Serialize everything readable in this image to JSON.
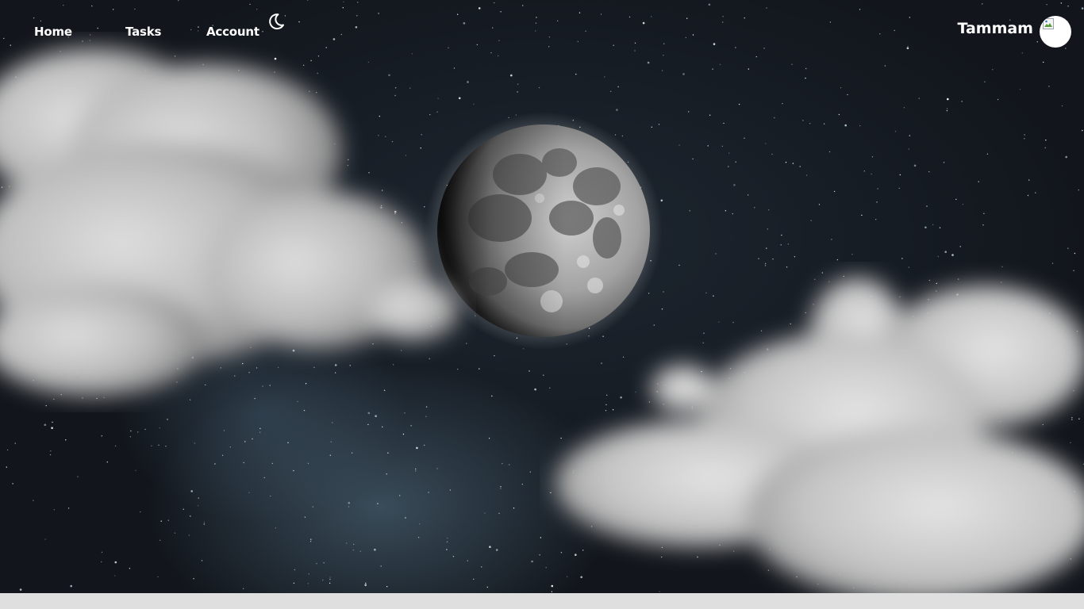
{
  "nav": {
    "links": [
      {
        "label": "Home"
      },
      {
        "label": "Tasks"
      },
      {
        "label": "Account"
      }
    ],
    "theme_toggle_icon": "crescent-moon-icon"
  },
  "user": {
    "name": "Tammam",
    "avatar_icon": "broken-image-icon"
  },
  "scene": {
    "description_icon": "night-sky-moon-clouds",
    "colors": {
      "sky": "#12161c",
      "moon": "#9a9a9a",
      "cloud": "#dcdcdc",
      "footer": "#e0dfdf"
    }
  }
}
